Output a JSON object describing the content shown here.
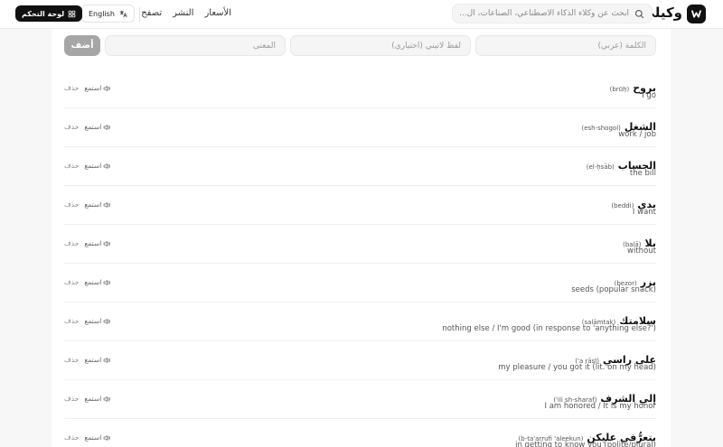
{
  "header": {
    "brand": "وكيلي",
    "search_placeholder": "ابحث عن وكلاء الذكاء الاصطناعي، الصناعات، ال...",
    "nav": [
      "تصفح",
      "النشر",
      "الأسعار"
    ],
    "language_label": "English",
    "dashboard_label": "لوحة التحكم"
  },
  "form": {
    "word_placeholder": "الكلمة (عربي)",
    "latin_placeholder": "لفظ لاتيني (اختياري)",
    "meaning_placeholder": "المعنى",
    "add_label": "أضف"
  },
  "actions": {
    "listen_label": "استمع",
    "delete_label": "حذف"
  },
  "words": [
    {
      "arabic": "بروح",
      "translit": "(brūḥ)",
      "meaning": "I go"
    },
    {
      "arabic": "الشغل",
      "translit": "(esh-shogol)",
      "meaning": "work / job"
    },
    {
      "arabic": "الحساب",
      "translit": "(el-ḥsāb)",
      "meaning": "the bill"
    },
    {
      "arabic": "بدي",
      "translit": "(beddi)",
      "meaning": "I want"
    },
    {
      "arabic": "بلا",
      "translit": "(balā)",
      "meaning": "without"
    },
    {
      "arabic": "بزر",
      "translit": "(bezor)",
      "meaning": "seeds (popular snack)"
    },
    {
      "arabic": "سلامتك",
      "translit": "(salāmtak)",
      "meaning": "nothing else / I'm good (in response to 'anything else?')"
    },
    {
      "arabic": "على راسي",
      "translit": "(a rāsī')",
      "meaning": "my pleasure / you got it (lit. on my head)"
    },
    {
      "arabic": "إلي الشرف",
      "translit": "(ili sh-sharaf')",
      "meaning": "I am honored / It is my honor"
    },
    {
      "arabic": "بتعرُّفي عليكن",
      "translit": "(b-ta'arrufi 'aleekun)",
      "meaning": "in getting to know you (polite/plural)"
    }
  ]
}
